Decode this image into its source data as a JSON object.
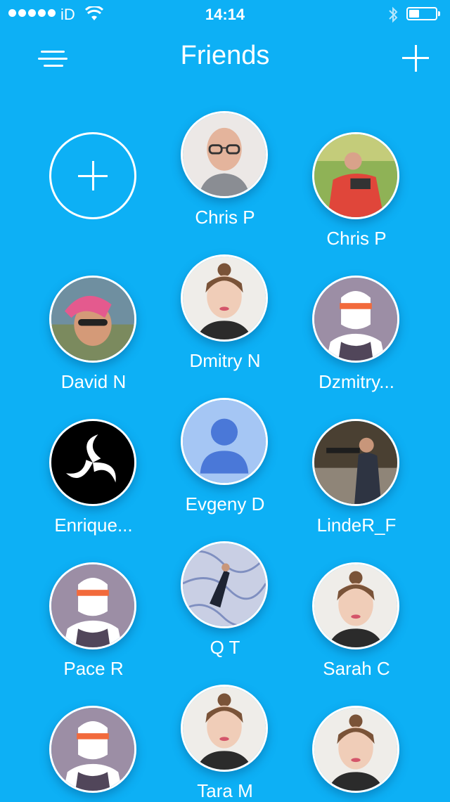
{
  "status_bar": {
    "carrier": "iD",
    "time": "14:14",
    "battery_level": 0.4
  },
  "nav": {
    "title": "Friends",
    "menu_icon": "filter-lines-icon",
    "add_icon": "plus-icon"
  },
  "friends": [
    {
      "name": "Chris P"
    },
    {
      "name": "Chris P"
    },
    {
      "name": "David N"
    },
    {
      "name": "Dmitry N"
    },
    {
      "name": "Dzmitry..."
    },
    {
      "name": "Enrique..."
    },
    {
      "name": "Evgeny D"
    },
    {
      "name": "LindeR_F"
    },
    {
      "name": "Pace R"
    },
    {
      "name": "Q T"
    },
    {
      "name": "Sarah C"
    },
    {
      "name": ""
    },
    {
      "name": "Tara M"
    },
    {
      "name": ""
    }
  ],
  "colors": {
    "background": "#0db0f5",
    "foreground": "#ffffff"
  }
}
